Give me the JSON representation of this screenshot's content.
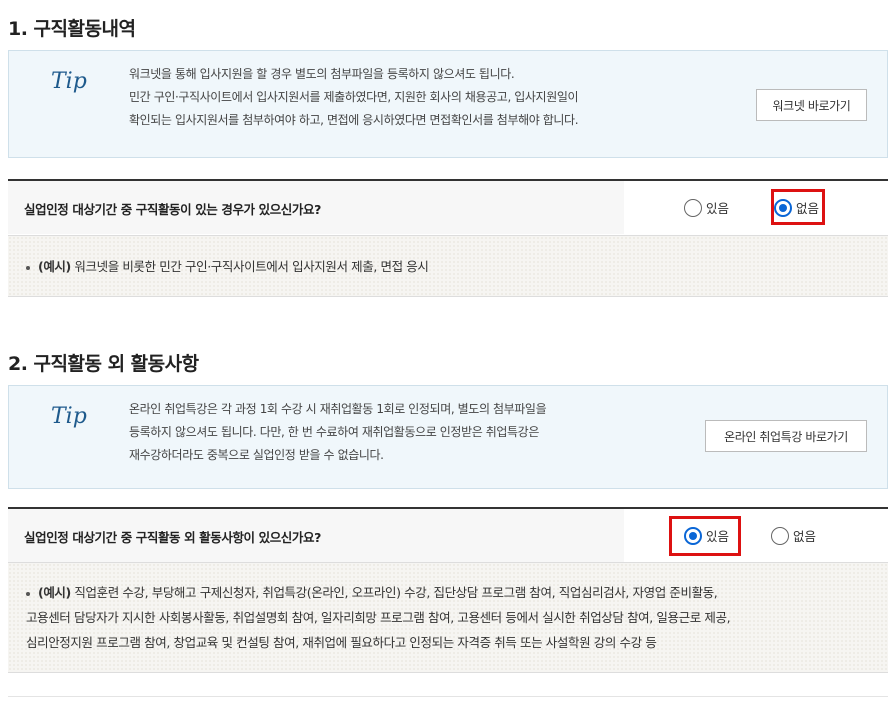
{
  "section1": {
    "title": "1. 구직활동내역",
    "tip_label": "Tip",
    "tip_lines": [
      "워크넷을 통해 입사지원을 할 경우 별도의 첨부파일을 등록하지 않으셔도 됩니다.",
      "민간 구인·구직사이트에서 입사지원서를 제출하였다면, 지원한 회사의 채용공고, 입사지원일이",
      "확인되는 입사지원서를 첨부하여야 하고, 면접에 응시하였다면 면접확인서를 첨부해야 합니다."
    ],
    "tip_button": "워크넷 바로가기",
    "question": "실업인정 대상기간 중 구직활동이 있는 경우가 있으신가요?",
    "option_yes": "있음",
    "option_no": "없음",
    "selected": "no",
    "example_label": "(예시)",
    "example_lines": [
      "워크넷을 비롯한 민간 구인·구직사이트에서 입사지원서 제출, 면접 응시"
    ]
  },
  "section2": {
    "title": "2. 구직활동 외 활동사항",
    "tip_label": "Tip",
    "tip_lines": [
      "온라인 취업특강은 각 과정 1회 수강 시 재취업활동 1회로 인정되며, 별도의 첨부파일을",
      "등록하지 않으셔도 됩니다. 다만, 한 번 수료하여 재취업활동으로 인정받은 취업특강은",
      "재수강하더라도 중복으로 실업인정 받을 수 없습니다."
    ],
    "tip_button": "온라인 취업특강 바로가기",
    "question": "실업인정 대상기간 중 구직활동 외 활동사항이 있으신가요?",
    "option_yes": "있음",
    "option_no": "없음",
    "selected": "yes",
    "example_label": "(예시)",
    "example_lines": [
      "직업훈련 수강, 부당해고 구제신청자, 취업특강(온라인, 오프라인) 수강, 집단상담 프로그램 참여, 직업심리검사, 자영업 준비활동,",
      "고용센터 담당자가 지시한 사회봉사활동, 취업설명회 참여, 일자리희망 프로그램 참여, 고용센터 등에서 실시한 취업상담 참여, 일용근로 제공,",
      "심리안정지원 프로그램 참여, 창업교육 및 컨설팅 참여, 재취업에 필요하다고 인정되는 자격증 취득 또는 사설학원 강의 수강 등"
    ]
  },
  "colors": {
    "accent": "#0a66d6",
    "highlight": "#dd1111",
    "tip_bg": "#f0f7fb"
  }
}
